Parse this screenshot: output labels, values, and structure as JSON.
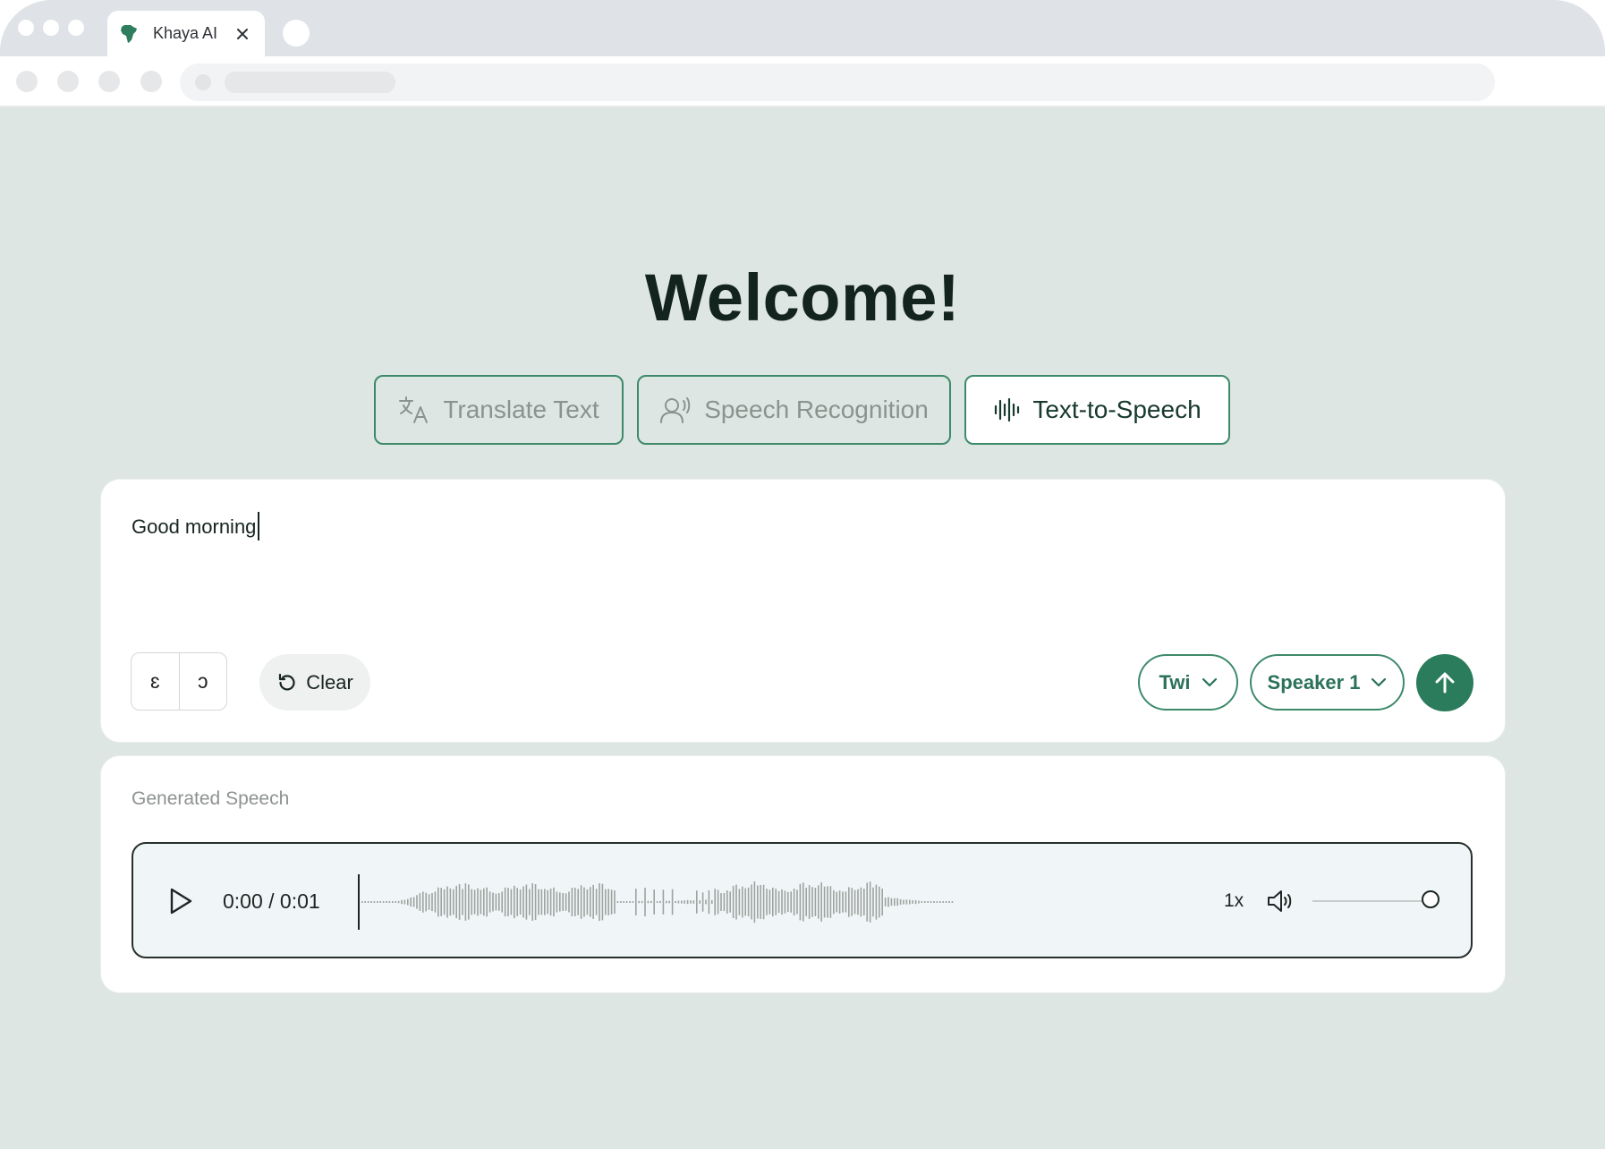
{
  "browser": {
    "tab_title": "Khaya AI"
  },
  "page": {
    "title": "Welcome!"
  },
  "mode_tabs": [
    {
      "label": "Translate Text",
      "icon": "translate-icon",
      "active": false
    },
    {
      "label": "Speech Recognition",
      "icon": "voice-recognition-icon",
      "active": false
    },
    {
      "label": "Text-to-Speech",
      "icon": "audio-waveform-icon",
      "active": true
    }
  ],
  "input": {
    "value": "Good morning",
    "special_chars": [
      "ɛ",
      "ɔ"
    ],
    "clear_label": "Clear",
    "language": "Twi",
    "speaker": "Speaker 1",
    "send_icon": "arrow-up-icon"
  },
  "output": {
    "label": "Generated Speech",
    "time": "0:00 / 0:01",
    "speed": "1x",
    "volume_level": 1.0,
    "progress": 0
  },
  "colors": {
    "background": "#dde6e2",
    "accent": "#2a7c5c",
    "heading": "#13231d"
  }
}
